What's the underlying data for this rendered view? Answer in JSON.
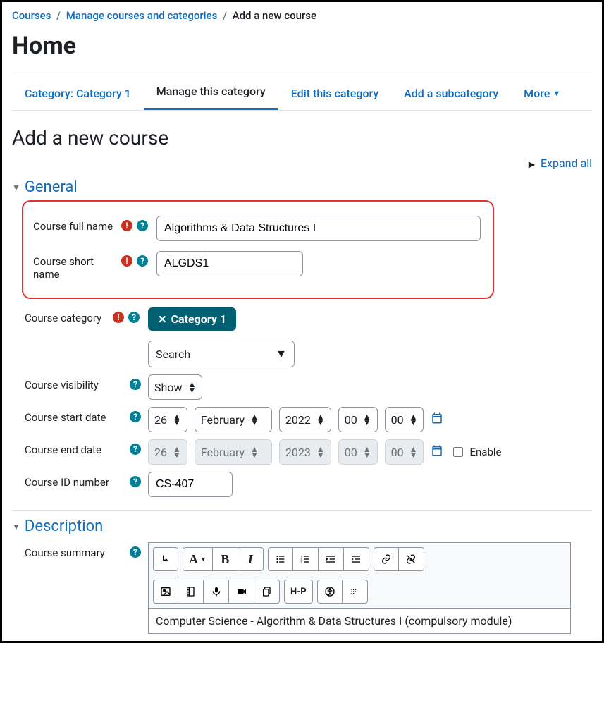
{
  "breadcrumb": {
    "courses": "Courses",
    "manage": "Manage courses and categories",
    "current": "Add a new course"
  },
  "home_title": "Home",
  "tabs": {
    "category": "Category: Category 1",
    "manage_this": "Manage this category",
    "edit_this": "Edit this category",
    "add_sub": "Add a subcategory",
    "more": "More"
  },
  "page_heading": "Add a new course",
  "expand_all": "Expand all",
  "sections": {
    "general": "General",
    "description": "Description"
  },
  "labels": {
    "full_name": "Course full name",
    "short_name": "Course short name",
    "category": "Course category",
    "visibility": "Course visibility",
    "start_date": "Course start date",
    "end_date": "Course end date",
    "id_number": "Course ID number",
    "summary": "Course summary"
  },
  "values": {
    "full_name": "Algorithms & Data Structures I",
    "short_name": "ALGDS1",
    "category_chip": "Category 1",
    "search_placeholder": "Search",
    "visibility": "Show",
    "start_day": "26",
    "start_month": "February",
    "start_year": "2022",
    "start_hour": "00",
    "start_min": "00",
    "end_day": "26",
    "end_month": "February",
    "end_year": "2023",
    "end_hour": "00",
    "end_min": "00",
    "enable_label": "Enable",
    "id_number": "CS-407",
    "summary_text": "Computer Science - Algorithm & Data Structures I (compulsory module)"
  },
  "editor": {
    "font_label": "A",
    "bold": "B",
    "italic": "I",
    "h5p": "H-P"
  }
}
